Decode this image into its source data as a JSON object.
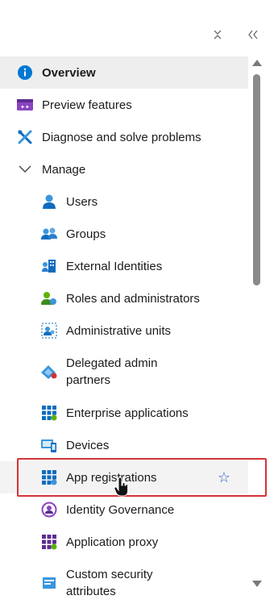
{
  "nav": {
    "items": [
      {
        "label": "Overview",
        "icon": "info-icon"
      },
      {
        "label": "Preview features",
        "icon": "preview-features-icon"
      },
      {
        "label": "Diagnose and solve problems",
        "icon": "tools-icon"
      },
      {
        "label": "Manage",
        "icon": "chevron-down-icon"
      },
      {
        "label": "Users",
        "icon": "user-icon"
      },
      {
        "label": "Groups",
        "icon": "groups-icon"
      },
      {
        "label": "External Identities",
        "icon": "external-identities-icon"
      },
      {
        "label": "Roles and administrators",
        "icon": "roles-icon"
      },
      {
        "label": "Administrative units",
        "icon": "administrative-units-icon"
      },
      {
        "label": "Delegated admin partners",
        "icon": "delegated-admin-icon"
      },
      {
        "label": "Enterprise applications",
        "icon": "enterprise-apps-icon"
      },
      {
        "label": "Devices",
        "icon": "devices-icon"
      },
      {
        "label": "App registrations",
        "icon": "app-registrations-icon"
      },
      {
        "label": "Identity Governance",
        "icon": "identity-governance-icon"
      },
      {
        "label": "Application proxy",
        "icon": "application-proxy-icon"
      },
      {
        "label": "Custom security attributes",
        "icon": "custom-security-icon"
      }
    ]
  },
  "colors": {
    "accent": "#0078d4",
    "highlight_border": "#d13438",
    "selected_bg": "#eeeeee",
    "star": "#2e62c9"
  }
}
